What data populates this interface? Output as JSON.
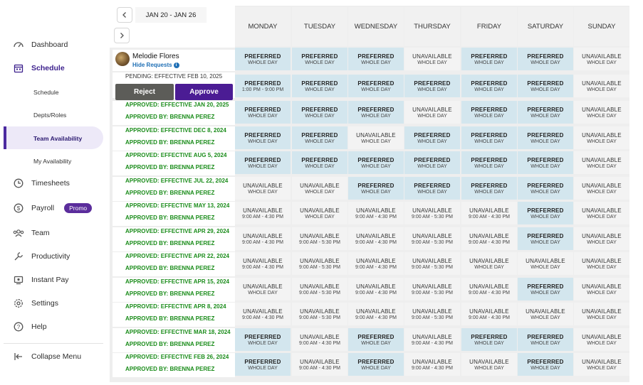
{
  "sidebar": {
    "items": [
      {
        "label": "Dashboard",
        "icon": "dashboard-icon"
      },
      {
        "label": "Schedule",
        "icon": "calendar-icon"
      },
      {
        "label": "Timesheets",
        "icon": "clock-icon"
      },
      {
        "label": "Payroll",
        "icon": "dollar-icon",
        "badge": "Promo"
      },
      {
        "label": "Team",
        "icon": "team-icon"
      },
      {
        "label": "Productivity",
        "icon": "wrench-icon"
      },
      {
        "label": "Instant Pay",
        "icon": "instant-pay-icon"
      },
      {
        "label": "Settings",
        "icon": "gear-icon"
      },
      {
        "label": "Help",
        "icon": "help-icon"
      }
    ],
    "schedule_sub": [
      "Schedule",
      "Depts/Roles",
      "Team Availability",
      "My Availability"
    ],
    "collapse_label": "Collapse Menu",
    "accent": "#4b2aa0"
  },
  "header": {
    "date_range": "JAN 20 - JAN 26",
    "days": [
      "MONDAY",
      "TUESDAY",
      "WEDNESDAY",
      "THURSDAY",
      "FRIDAY",
      "SATURDAY",
      "SUNDAY"
    ]
  },
  "employee": {
    "name": "Melodie Flores",
    "hide_requests": "Hide Requests"
  },
  "pending": {
    "text": "PENDING: EFFECTIVE FEB 10, 2025",
    "reject": "Reject",
    "approve": "Approve"
  },
  "current_row": [
    {
      "status": "PREFERRED",
      "time": "WHOLE DAY"
    },
    {
      "status": "PREFERRED",
      "time": "WHOLE DAY"
    },
    {
      "status": "PREFERRED",
      "time": "WHOLE DAY"
    },
    {
      "status": "UNAVAILABLE",
      "time": "WHOLE DAY"
    },
    {
      "status": "PREFERRED",
      "time": "WHOLE DAY"
    },
    {
      "status": "PREFERRED",
      "time": "WHOLE DAY"
    },
    {
      "status": "UNAVAILABLE",
      "time": "WHOLE DAY"
    }
  ],
  "pending_row": [
    {
      "status": "PREFERRED",
      "time": "1:00 PM - 9:00 PM"
    },
    {
      "status": "PREFERRED",
      "time": "WHOLE DAY"
    },
    {
      "status": "PREFERRED",
      "time": "WHOLE DAY"
    },
    {
      "status": "PREFERRED",
      "time": "WHOLE DAY"
    },
    {
      "status": "PREFERRED",
      "time": "WHOLE DAY"
    },
    {
      "status": "PREFERRED",
      "time": "WHOLE DAY"
    },
    {
      "status": "UNAVAILABLE",
      "time": "WHOLE DAY"
    }
  ],
  "requests": [
    {
      "effective": "APPROVED: EFFECTIVE JAN 20, 2025",
      "approved_by": "APPROVED BY: BRENNA PEREZ",
      "cells": [
        [
          "PREFERRED",
          "WHOLE DAY"
        ],
        [
          "PREFERRED",
          "WHOLE DAY"
        ],
        [
          "PREFERRED",
          "WHOLE DAY"
        ],
        [
          "UNAVAILABLE",
          "WHOLE DAY"
        ],
        [
          "PREFERRED",
          "WHOLE DAY"
        ],
        [
          "PREFERRED",
          "WHOLE DAY"
        ],
        [
          "UNAVAILABLE",
          "WHOLE DAY"
        ]
      ]
    },
    {
      "effective": "APPROVED: EFFECTIVE DEC 8, 2024",
      "approved_by": "APPROVED BY: BRENNA PEREZ",
      "cells": [
        [
          "PREFERRED",
          "WHOLE DAY"
        ],
        [
          "PREFERRED",
          "WHOLE DAY"
        ],
        [
          "UNAVAILABLE",
          "WHOLE DAY"
        ],
        [
          "PREFERRED",
          "WHOLE DAY"
        ],
        [
          "PREFERRED",
          "WHOLE DAY"
        ],
        [
          "PREFERRED",
          "WHOLE DAY"
        ],
        [
          "UNAVAILABLE",
          "WHOLE DAY"
        ]
      ]
    },
    {
      "effective": "APPROVED: EFFECTIVE AUG 5, 2024",
      "approved_by": "APPROVED BY: BRENNA PEREZ",
      "cells": [
        [
          "PREFERRED",
          "WHOLE DAY"
        ],
        [
          "PREFERRED",
          "WHOLE DAY"
        ],
        [
          "PREFERRED",
          "WHOLE DAY"
        ],
        [
          "PREFERRED",
          "WHOLE DAY"
        ],
        [
          "PREFERRED",
          "WHOLE DAY"
        ],
        [
          "PREFERRED",
          "WHOLE DAY"
        ],
        [
          "UNAVAILABLE",
          "WHOLE DAY"
        ]
      ]
    },
    {
      "effective": "APPROVED: EFFECTIVE JUL 22, 2024",
      "approved_by": "APPROVED BY: BRENNA PEREZ",
      "cells": [
        [
          "UNAVAILABLE",
          "WHOLE DAY"
        ],
        [
          "UNAVAILABLE",
          "WHOLE DAY"
        ],
        [
          "PREFERRED",
          "WHOLE DAY"
        ],
        [
          "PREFERRED",
          "WHOLE DAY"
        ],
        [
          "PREFERRED",
          "WHOLE DAY"
        ],
        [
          "PREFERRED",
          "WHOLE DAY"
        ],
        [
          "UNAVAILABLE",
          "WHOLE DAY"
        ]
      ]
    },
    {
      "effective": "APPROVED: EFFECTIVE MAY 13, 2024",
      "approved_by": "APPROVED BY: BRENNA PEREZ",
      "cells": [
        [
          "UNAVAILABLE",
          "9:00 AM - 4:30 PM"
        ],
        [
          "UNAVAILABLE",
          "WHOLE DAY"
        ],
        [
          "UNAVAILABLE",
          "9:00 AM - 4:30 PM"
        ],
        [
          "UNAVAILABLE",
          "9:00 AM - 5:30 PM"
        ],
        [
          "UNAVAILABLE",
          "9:00 AM - 4:30 PM"
        ],
        [
          "PREFERRED",
          "WHOLE DAY"
        ],
        [
          "UNAVAILABLE",
          "WHOLE DAY"
        ]
      ]
    },
    {
      "effective": "APPROVED: EFFECTIVE APR 29, 2024",
      "approved_by": "APPROVED BY: BRENNA PEREZ",
      "cells": [
        [
          "UNAVAILABLE",
          "9:00 AM - 4:30 PM"
        ],
        [
          "UNAVAILABLE",
          "9:00 AM - 5:30 PM"
        ],
        [
          "UNAVAILABLE",
          "9:00 AM - 4:30 PM"
        ],
        [
          "UNAVAILABLE",
          "9:00 AM - 5:30 PM"
        ],
        [
          "UNAVAILABLE",
          "9:00 AM - 4:30 PM"
        ],
        [
          "PREFERRED",
          "WHOLE DAY"
        ],
        [
          "UNAVAILABLE",
          "WHOLE DAY"
        ]
      ]
    },
    {
      "effective": "APPROVED: EFFECTIVE APR 22, 2024",
      "approved_by": "APPROVED BY: BRENNA PEREZ",
      "cells": [
        [
          "UNAVAILABLE",
          "9:00 AM - 4:30 PM"
        ],
        [
          "UNAVAILABLE",
          "9:00 AM - 5:30 PM"
        ],
        [
          "UNAVAILABLE",
          "9:00 AM - 4:30 PM"
        ],
        [
          "UNAVAILABLE",
          "9:00 AM - 5:30 PM"
        ],
        [
          "UNAVAILABLE",
          "WHOLE DAY"
        ],
        [
          "UNAVAILABLE",
          "WHOLE DAY"
        ],
        [
          "UNAVAILABLE",
          "WHOLE DAY"
        ]
      ]
    },
    {
      "effective": "APPROVED: EFFECTIVE APR 15, 2024",
      "approved_by": "APPROVED BY: BRENNA PEREZ",
      "cells": [
        [
          "UNAVAILABLE",
          "WHOLE DAY"
        ],
        [
          "UNAVAILABLE",
          "9:00 AM - 5:30 PM"
        ],
        [
          "UNAVAILABLE",
          "9:00 AM - 4:30 PM"
        ],
        [
          "UNAVAILABLE",
          "9:00 AM - 5:30 PM"
        ],
        [
          "UNAVAILABLE",
          "9:00 AM - 4:30 PM"
        ],
        [
          "PREFERRED",
          "WHOLE DAY"
        ],
        [
          "UNAVAILABLE",
          "WHOLE DAY"
        ]
      ]
    },
    {
      "effective": "APPROVED: EFFECTIVE APR 8, 2024",
      "approved_by": "APPROVED BY: BRENNA PEREZ",
      "cells": [
        [
          "UNAVAILABLE",
          "9:00 AM - 4:30 PM"
        ],
        [
          "UNAVAILABLE",
          "9:00 AM - 5:30 PM"
        ],
        [
          "UNAVAILABLE",
          "9:00 AM - 4:30 PM"
        ],
        [
          "UNAVAILABLE",
          "9:00 AM - 5:30 PM"
        ],
        [
          "UNAVAILABLE",
          "9:00 AM - 4:30 PM"
        ],
        [
          "UNAVAILABLE",
          "WHOLE DAY"
        ],
        [
          "UNAVAILABLE",
          "WHOLE DAY"
        ]
      ]
    },
    {
      "effective": "APPROVED: EFFECTIVE MAR 18, 2024",
      "approved_by": "APPROVED BY: BRENNA PEREZ",
      "cells": [
        [
          "PREFERRED",
          "WHOLE DAY"
        ],
        [
          "UNAVAILABLE",
          "9:00 AM - 4:30 PM"
        ],
        [
          "PREFERRED",
          "WHOLE DAY"
        ],
        [
          "UNAVAILABLE",
          "9:00 AM - 4:30 PM"
        ],
        [
          "PREFERRED",
          "WHOLE DAY"
        ],
        [
          "PREFERRED",
          "WHOLE DAY"
        ],
        [
          "UNAVAILABLE",
          "WHOLE DAY"
        ]
      ]
    },
    {
      "effective": "APPROVED: EFFECTIVE FEB 26, 2024",
      "approved_by": "APPROVED BY: BRENNA PEREZ",
      "cells": [
        [
          "PREFERRED",
          "WHOLE DAY"
        ],
        [
          "UNAVAILABLE",
          "9:00 AM - 4:30 PM"
        ],
        [
          "PREFERRED",
          "WHOLE DAY"
        ],
        [
          "UNAVAILABLE",
          "9:00 AM - 4:30 PM"
        ],
        [
          "UNAVAILABLE",
          "WHOLE DAY"
        ],
        [
          "PREFERRED",
          "WHOLE DAY"
        ],
        [
          "UNAVAILABLE",
          "WHOLE DAY"
        ]
      ]
    }
  ],
  "colors": {
    "preferred": "#d3e6ee",
    "unavailable": "#f3f3f3",
    "approved_text": "#1a8c1a",
    "approve_btn": "#4b1c94",
    "reject_btn": "#5c5c58"
  }
}
